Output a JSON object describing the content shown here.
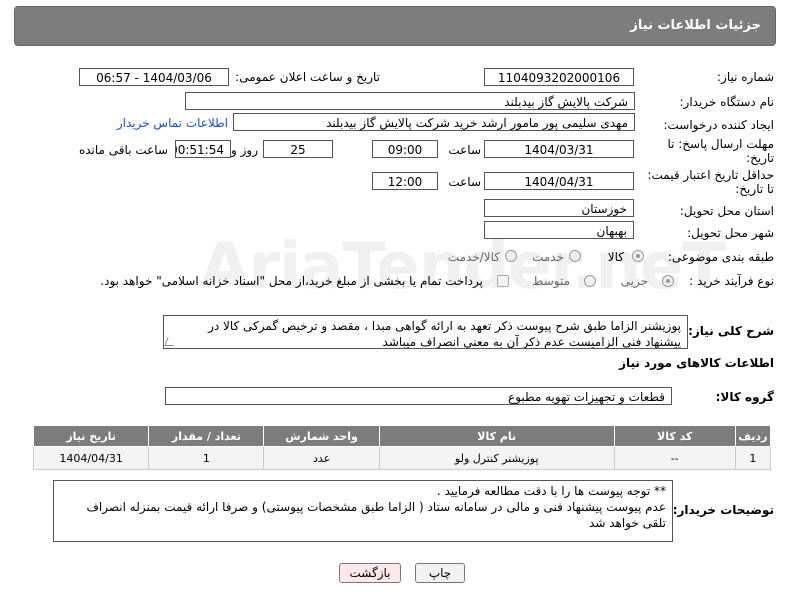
{
  "header": {
    "title": "جزئیات اطلاعات نیاز"
  },
  "form": {
    "need_number_label": "شماره نیاز:",
    "need_number": "1104093202000106",
    "announce_label": "تاریخ و ساعت اعلان عمومی:",
    "announce_value": "1404/03/06 - 06:57",
    "buyer_org_label": "نام دستگاه خریدار:",
    "buyer_org": "شرکت پالایش گاز بیدبلند",
    "creator_label": "ایجاد کننده درخواست:",
    "creator": "مهدی سلیمی پور مامور ارشد خرید شرکت پالایش گاز بیدبلند",
    "contact_link": "اطلاعات تماس خریدار",
    "deadline_label_1": "مهلت ارسال پاسخ: تا",
    "deadline_label_2": "تاریخ:",
    "deadline_date": "1404/03/31",
    "time_label": "ساعت",
    "deadline_time": "09:00",
    "days_value": "25",
    "days_label": "روز و",
    "remaining_value": "00:51:54",
    "remaining_label": "ساعت باقی مانده",
    "min_validity_label_1": "حداقل تاریخ اعتبار قیمت:",
    "min_validity_label_2": "تا تاریخ:",
    "validity_date": "1404/04/31",
    "validity_time_label": "ساعت",
    "validity_time": "12:00",
    "province_label": "استان محل تحویل:",
    "province": "خوزستان",
    "city_label": "شهر محل تحویل:",
    "city": "بهبهان",
    "category_label": "طبقه بندی موضوعی:",
    "category_options": [
      "کالا",
      "خدمت",
      "کالا/خدمت"
    ],
    "process_label": "نوع فرآیند خرید :",
    "process_options": [
      "جزیی",
      "متوسط"
    ],
    "payment_note": "پرداخت تمام یا بخشی از مبلغ خرید،از محل \"اسناد خزانه اسلامی\" خواهد بود."
  },
  "description": {
    "label": "شرح کلی نیاز:",
    "text": "پوزیشنر   الزاما طبق شرح  پیوست  ذکر تعهد به ارائه گواهی مبدا ، مقصد و ترخیص گمرکی کالا در پیشنهاد فنی الزامیست عدم ذکر آن به معنی انصراف میباشد"
  },
  "items_section": {
    "title": "اطلاعات کالاهای مورد نیاز",
    "group_label": "گروه کالا:",
    "group_value": "قطعات و تجهیزات تهویه مطبوع",
    "columns": [
      "ردیف",
      "کد کالا",
      "نام کالا",
      "واحد شمارش",
      "تعداد / مقدار",
      "تاریخ نیاز"
    ],
    "rows": [
      {
        "row": "1",
        "code": "--",
        "name": "پوزیشنر کنترل ولو",
        "unit": "عدد",
        "qty": "1",
        "date": "1404/04/31"
      }
    ]
  },
  "buyer_notes": {
    "label": "توضیحات خریدار:",
    "line1": "** توجه پیوست ها  را با دقت مطالعه فرمایید .",
    "line2": "عدم پیوست پیشنهاد فنی و مالی در سامانه ستاد ( الزاما طبق مشخصات پیوستی)  و صرفا ارائه قیمت بمنزله انصراف تلقی خواهد شد"
  },
  "buttons": {
    "print": "چاپ",
    "back": "بازگشت"
  },
  "watermark": "AriaTender.neT"
}
